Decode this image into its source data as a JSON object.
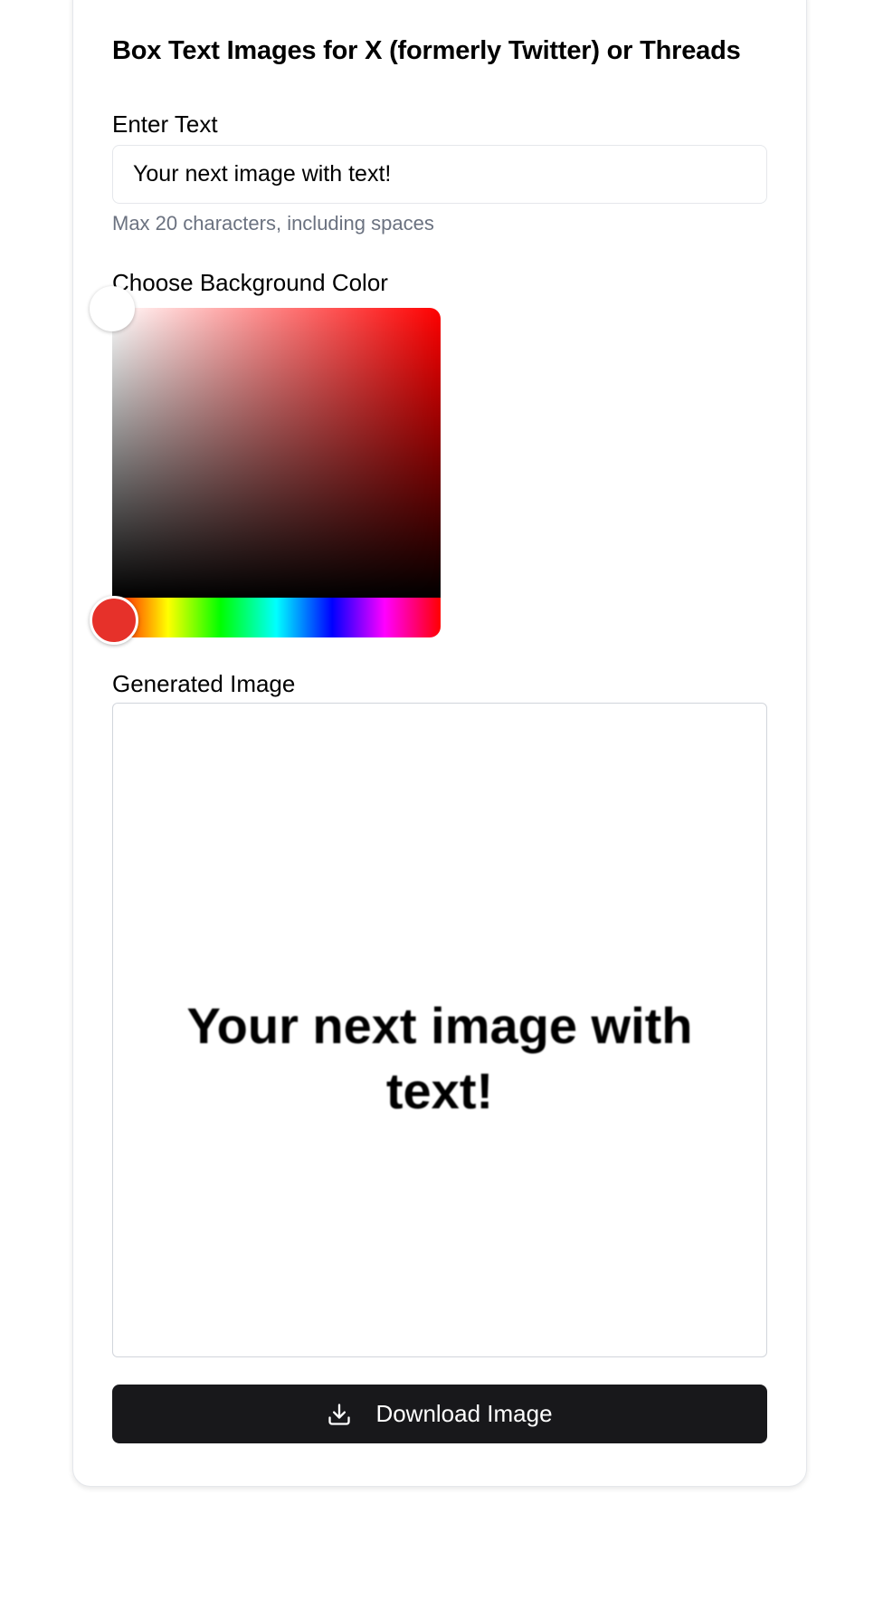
{
  "header": {
    "title": "Box Text Images for X (formerly Twitter) or Threads"
  },
  "text_field": {
    "label": "Enter Text",
    "value": "Your next image with text!",
    "hint": "Max 20 characters, including spaces"
  },
  "color_picker": {
    "label": "Choose Background Color",
    "hue_color": "#ff0000",
    "selected_color": "#ffffff",
    "hue_handle_color": "#e6312a"
  },
  "preview": {
    "label": "Generated Image",
    "text": "Your next image with text!",
    "background": "#ffffff"
  },
  "download": {
    "label": "Download Image",
    "icon": "download-icon"
  }
}
